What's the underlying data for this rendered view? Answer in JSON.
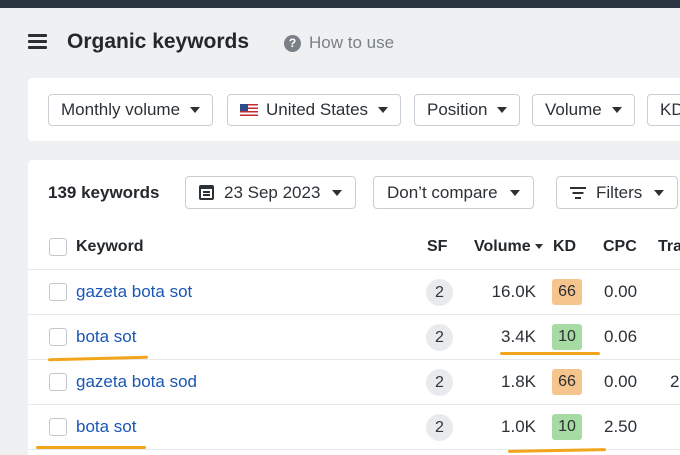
{
  "header": {
    "title": "Organic keywords",
    "help_label": "How to use",
    "help_icon": "?"
  },
  "filters": {
    "monthly_volume": "Monthly volume",
    "country": "United States",
    "position": "Position",
    "volume": "Volume",
    "kd": "KD"
  },
  "toolbar": {
    "count": "139 keywords",
    "date": "23 Sep 2023",
    "compare": "Don’t compare",
    "filters": "Filters"
  },
  "table": {
    "columns": {
      "keyword": "Keyword",
      "sf": "SF",
      "volume": "Volume",
      "kd": "KD",
      "cpc": "CPC",
      "traffic": "Tra"
    },
    "rows": [
      {
        "keyword": "gazeta bota sot",
        "sf": "2",
        "volume": "16.0K",
        "kd": "66",
        "cpc": "0.00",
        "traffic": "",
        "kd_color": "#f6c48d"
      },
      {
        "keyword": "bota sot",
        "sf": "2",
        "volume": "3.4K",
        "kd": "10",
        "cpc": "0.06",
        "traffic": "",
        "kd_color": "#a6dba3"
      },
      {
        "keyword": "gazeta bota sod",
        "sf": "2",
        "volume": "1.8K",
        "kd": "66",
        "cpc": "0.00",
        "traffic": "2",
        "kd_color": "#f6c48d"
      },
      {
        "keyword": "bota sot",
        "sf": "2",
        "volume": "1.0K",
        "kd": "10",
        "cpc": "2.50",
        "traffic": "",
        "kd_color": "#a6dba3"
      }
    ]
  },
  "colors": {
    "accent_underline": "#f2a51a",
    "link": "#1a56b4"
  }
}
